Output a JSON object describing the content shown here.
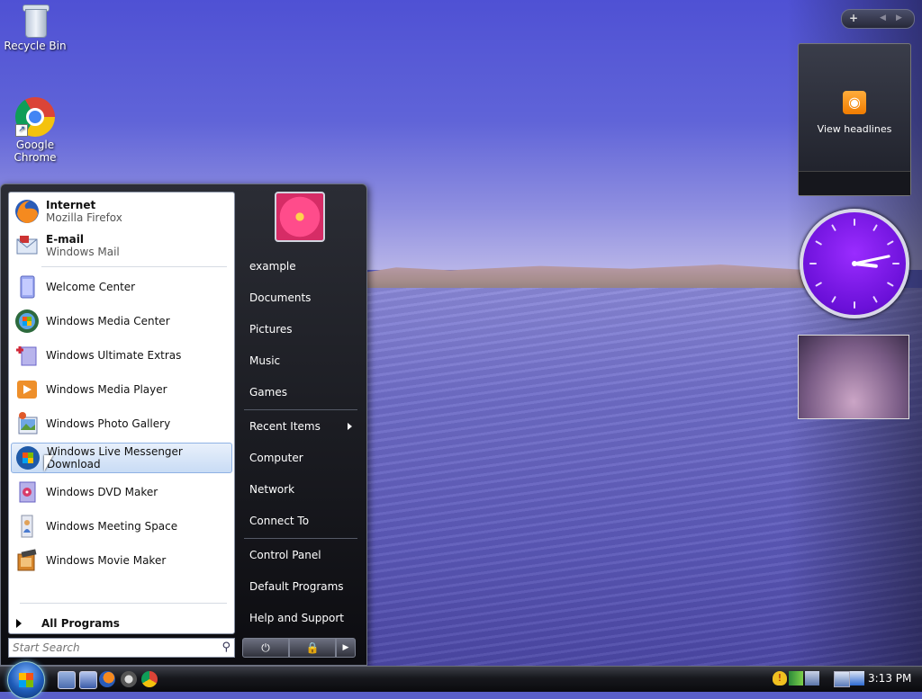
{
  "desktop": {
    "icons": [
      {
        "label": "Recycle Bin",
        "icon": "recycle-bin-icon"
      },
      {
        "label": "Google Chrome",
        "icon": "chrome-icon"
      }
    ]
  },
  "sidebar": {
    "controls": {
      "add": "+",
      "prev": "◀",
      "next": "▶"
    },
    "feed": {
      "label": "View headlines",
      "icon": "rss-icon",
      "color": "#f28a00"
    },
    "clock": {
      "hour": 3,
      "minute": 13,
      "color": "#7a18ec"
    },
    "slideshow": {
      "icon": "photo-slideshow-icon"
    }
  },
  "start_menu": {
    "pinned": [
      {
        "title": "Internet",
        "subtitle": "Mozilla Firefox",
        "icon": "firefox-icon"
      },
      {
        "title": "E-mail",
        "subtitle": "Windows Mail",
        "icon": "mail-icon"
      }
    ],
    "recent": [
      {
        "label": "Welcome Center",
        "icon": "welcome-center-icon"
      },
      {
        "label": "Windows Media Center",
        "icon": "media-center-icon"
      },
      {
        "label": "Windows Ultimate Extras",
        "icon": "ultimate-extras-icon"
      },
      {
        "label": "Windows Media Player",
        "icon": "media-player-icon"
      },
      {
        "label": "Windows Photo Gallery",
        "icon": "photo-gallery-icon"
      },
      {
        "label": "Windows Live Messenger Download",
        "icon": "messenger-icon",
        "highlighted": true
      },
      {
        "label": "Windows DVD Maker",
        "icon": "dvd-maker-icon"
      },
      {
        "label": "Windows Meeting Space",
        "icon": "meeting-space-icon"
      },
      {
        "label": "Windows Movie Maker",
        "icon": "movie-maker-icon"
      }
    ],
    "all_programs": "All Programs",
    "search_placeholder": "Start Search",
    "right_links": [
      "example",
      "Documents",
      "Pictures",
      "Music",
      "Games",
      "Recent Items",
      "Computer",
      "Network",
      "Connect To",
      "Control Panel",
      "Default Programs",
      "Help and Support"
    ],
    "power": {
      "power": "⏻",
      "lock": "🔒",
      "more": "▶"
    }
  },
  "taskbar": {
    "quick_launch": [
      "show-desktop-icon",
      "switch-windows-icon",
      "firefox-icon",
      "utility-icon",
      "chrome-icon"
    ],
    "tray_icons": [
      "security-alert-icon",
      "network-icon",
      "volume-icon",
      "display-icon"
    ],
    "time": "3:13 PM"
  },
  "colors": {
    "accent": "#1e5bb8",
    "highlight": "#c9dcf5"
  }
}
